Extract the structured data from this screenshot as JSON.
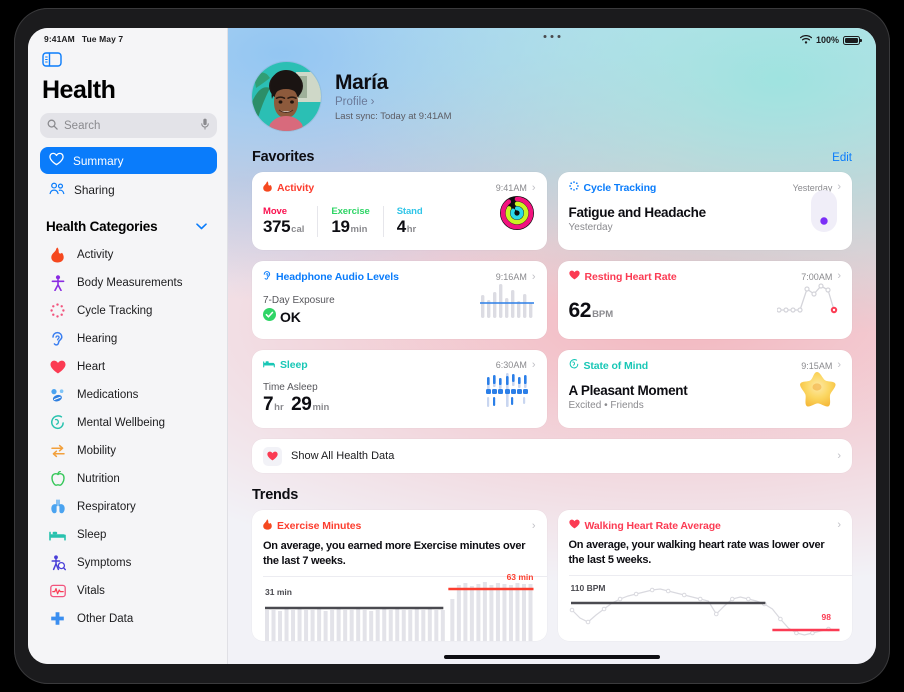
{
  "sidebar": {
    "status_time": "9:41AM",
    "status_date": "Tue May 7",
    "app_title": "Health",
    "search_placeholder": "Search",
    "nav": [
      {
        "label": "Summary",
        "icon": "heart-outline-icon",
        "active": true
      },
      {
        "label": "Sharing",
        "icon": "people-icon",
        "active": false
      }
    ],
    "categories_header": "Health Categories",
    "categories": [
      {
        "label": "Activity",
        "icon": "flame-icon"
      },
      {
        "label": "Body Measurements",
        "icon": "body-icon"
      },
      {
        "label": "Cycle Tracking",
        "icon": "cycle-icon"
      },
      {
        "label": "Hearing",
        "icon": "ear-icon"
      },
      {
        "label": "Heart",
        "icon": "heart-icon"
      },
      {
        "label": "Medications",
        "icon": "pills-icon"
      },
      {
        "label": "Mental Wellbeing",
        "icon": "brain-icon"
      },
      {
        "label": "Mobility",
        "icon": "mobility-icon"
      },
      {
        "label": "Nutrition",
        "icon": "apple-icon"
      },
      {
        "label": "Respiratory",
        "icon": "lungs-icon"
      },
      {
        "label": "Sleep",
        "icon": "bed-icon"
      },
      {
        "label": "Symptoms",
        "icon": "symptoms-icon"
      },
      {
        "label": "Vitals",
        "icon": "vitals-icon"
      },
      {
        "label": "Other Data",
        "icon": "cross-icon"
      }
    ]
  },
  "statusbar": {
    "battery_text": "100%",
    "wifi": "wifi-icon"
  },
  "profile": {
    "name": "María",
    "link": "Profile",
    "last_sync": "Last sync: Today at 9:41AM"
  },
  "favorites": {
    "title": "Favorites",
    "edit": "Edit",
    "cards": [
      {
        "id": "activity",
        "title": "Activity",
        "accent": "#fc3d2e",
        "time": "9:41AM",
        "metrics": [
          {
            "label": "Move",
            "color": "#fa114f",
            "value": "375",
            "unit": "cal"
          },
          {
            "label": "Exercise",
            "color": "#2fd566",
            "value": "19",
            "unit": "min"
          },
          {
            "label": "Stand",
            "color": "#30c5e8",
            "value": "4",
            "unit": "hr"
          }
        ]
      },
      {
        "id": "cycle-tracking",
        "title": "Cycle Tracking",
        "accent": "#0a7cfb",
        "time": "Yesterday",
        "headline": "Fatigue and Headache",
        "sub": "Yesterday"
      },
      {
        "id": "headphone-audio-levels",
        "title": "Headphone Audio Levels",
        "accent": "#0a7cfb",
        "time": "9:16AM",
        "label": "7-Day Exposure",
        "status": "OK"
      },
      {
        "id": "resting-heart-rate",
        "title": "Resting Heart Rate",
        "accent": "#fb3b53",
        "time": "7:00AM",
        "value": "62",
        "unit": "BPM"
      },
      {
        "id": "sleep",
        "title": "Sleep",
        "accent": "#19c7b6",
        "time": "6:30AM",
        "label": "Time Asleep",
        "value_hr": "7",
        "unit_hr": "hr",
        "value_min": "29",
        "unit_min": "min"
      },
      {
        "id": "state-of-mind",
        "title": "State of Mind",
        "accent": "#19c7b6",
        "time": "9:15AM",
        "headline": "A Pleasant Moment",
        "sub": "Excited • Friends"
      }
    ],
    "show_all": "Show All Health Data"
  },
  "trends": {
    "title": "Trends",
    "cards": [
      {
        "id": "exercise-minutes",
        "title": "Exercise Minutes",
        "accent": "#fc3d2e",
        "desc": "On average, you earned more Exercise minutes over the last 7 weeks.",
        "baseline_label": "31 min",
        "current_label": "63 min"
      },
      {
        "id": "walking-heart-rate-average",
        "title": "Walking Heart Rate Average",
        "accent": "#fb3b53",
        "desc": "On average, your walking heart rate was lower over the last 5 weeks.",
        "baseline_label": "110 BPM",
        "current_label": "98"
      }
    ]
  },
  "chart_data": [
    {
      "type": "bar",
      "id": "exercise-minutes-trend",
      "title": "Exercise Minutes",
      "ylabel": "minutes",
      "baseline": 31,
      "baseline_label": "31 min",
      "current": 63,
      "current_label": "63 min",
      "values": [
        30,
        31,
        29,
        32,
        30,
        33,
        31,
        30,
        32,
        29,
        31,
        33,
        30,
        31,
        32,
        30,
        29,
        31,
        33,
        30,
        32,
        31,
        30,
        33,
        31,
        32,
        30,
        31,
        48,
        62,
        64,
        61,
        63,
        65,
        62,
        64,
        63,
        62,
        64,
        63
      ],
      "n_bars": 40,
      "highlight_from_index": 28
    },
    {
      "type": "line",
      "id": "walking-heart-rate-trend",
      "title": "Walking Heart Rate Average",
      "ylabel": "BPM",
      "baseline": 110,
      "baseline_label": "110 BPM",
      "current": 98,
      "current_label": "98",
      "values": [
        104,
        99,
        97,
        101,
        104,
        107,
        109,
        110,
        111,
        112,
        113,
        114,
        115,
        114,
        113,
        112,
        111,
        110,
        105,
        108,
        111,
        112,
        111,
        110,
        109,
        107,
        103,
        99,
        96,
        95,
        96,
        97,
        98,
        99,
        98
      ],
      "ylim": [
        92,
        118
      ]
    }
  ]
}
